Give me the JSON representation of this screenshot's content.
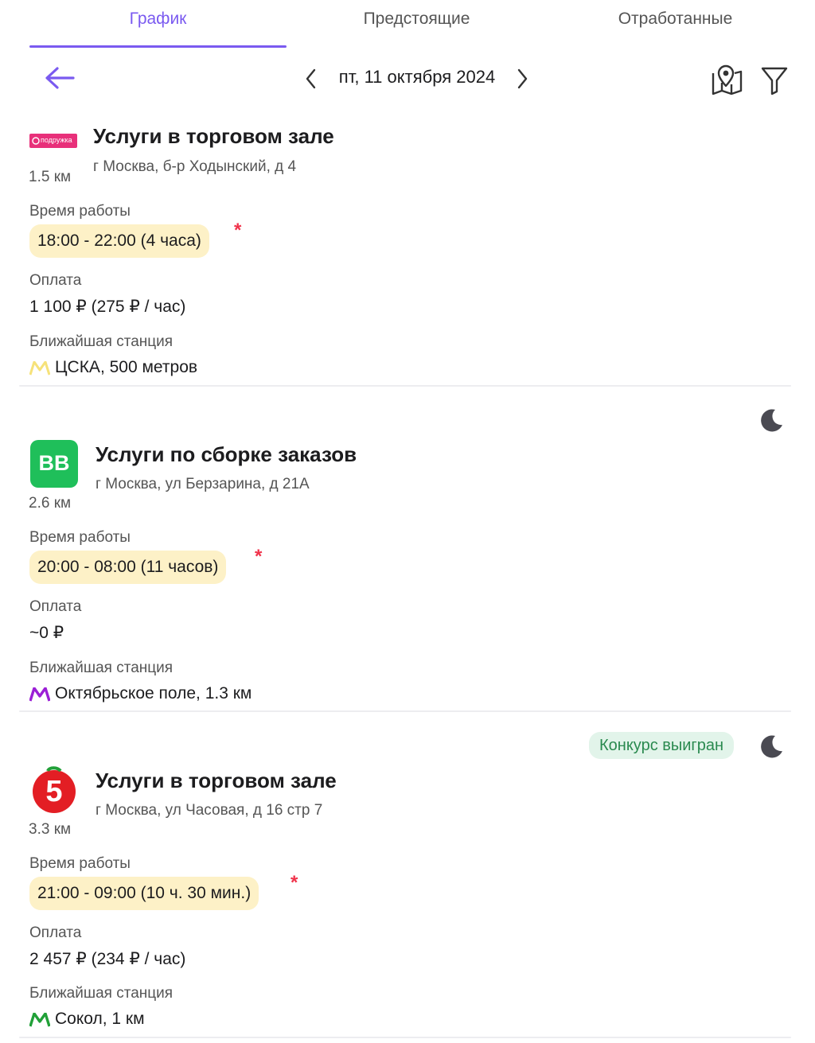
{
  "tabs": [
    {
      "label": "График",
      "active": true
    },
    {
      "label": "Предстоящие",
      "active": false
    },
    {
      "label": "Отработанные",
      "active": false
    }
  ],
  "toolbar": {
    "date": "пт, 11 октября 2024",
    "icons": [
      "arrow-left-icon",
      "chevron-left-icon",
      "chevron-right-icon",
      "map-pin-icon",
      "filter-icon"
    ]
  },
  "colors": {
    "accent": "#7a5af0",
    "time_pill_bg": "#fdf1c7",
    "required_star": "#f0324a",
    "badge_bg": "#e2f4ea",
    "badge_text": "#2a8a4f"
  },
  "shifts": [
    {
      "logo_text": "подружка",
      "distance": "1.5 км",
      "title": "Услуги в торговом зале",
      "address": "г Москва, б-р Ходынский, д 4",
      "work_time_label": "Время работы",
      "work_time": "18:00 - 22:00 (4 часа)",
      "payment_label": "Оплата",
      "payment": "1 100 ₽ (275 ₽ / час)",
      "station_label": "Ближайшая станция",
      "station": "ЦСКА, 500 метров",
      "metro_color": "#f6e27a",
      "night": false
    },
    {
      "logo_text": "ВВ",
      "distance": "2.6 км",
      "title": "Услуги по сборке заказов",
      "address": "г Москва, ул Берзарина, д 21А",
      "work_time_label": "Время работы",
      "work_time": "20:00 - 08:00 (11 часов)",
      "payment_label": "Оплата",
      "payment": "~0 ₽",
      "station_label": "Ближайшая станция",
      "station": "Октябрьское поле, 1.3 км",
      "metro_color": "#9b1fd6",
      "night": true
    },
    {
      "logo_text": "5",
      "distance": "3.3 км",
      "title": "Услуги в торговом зале",
      "address": "г Москва, ул Часовая, д 16 стр 7",
      "work_time_label": "Время работы",
      "work_time": "21:00 - 09:00 (10 ч. 30 мин.)",
      "payment_label": "Оплата",
      "payment": "2 457 ₽ (234 ₽ / час)",
      "station_label": "Ближайшая станция",
      "station": "Сокол, 1 км",
      "metro_color": "#21a038",
      "badge": "Конкурс выигран",
      "night": true
    }
  ]
}
